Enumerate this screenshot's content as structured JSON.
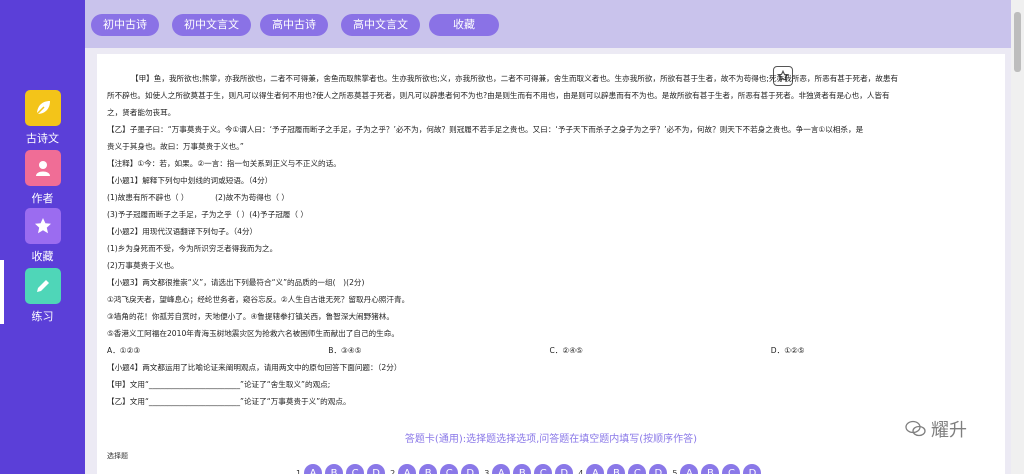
{
  "sidebar": {
    "items": [
      {
        "label": "古诗文",
        "icon": "leaf-icon",
        "color": "#f3c419"
      },
      {
        "label": "作者",
        "icon": "person-icon",
        "color": "#f06d96"
      },
      {
        "label": "收藏",
        "icon": "star-icon",
        "color": "#9b6cf0"
      },
      {
        "label": "练习",
        "icon": "pencil-icon",
        "color": "#4fd6b8"
      }
    ]
  },
  "tabs": [
    "初中古诗",
    "初中文言文",
    "高中古诗",
    "高中文言文",
    "收藏"
  ],
  "passage": [
    "【甲】鱼，我所欲也;熊掌，亦我所欲也，二者不可得兼，舍鱼而取熊掌者也。生亦我所欲也;义，亦我所欲也，二者不可得兼，舍生而取义者也。生亦我所欲，所欲有甚于生者，故不为苟得也;死亦我所恶，所恶有甚于死者，故患有",
    "所不辟也。如使人之所欲莫甚于生，则凡可以得生者何不用也?使人之所恶莫甚于死者，则凡可以辟患者何不为也?由是则生而有不用也，由是则可以辟患而有不为也。是故所欲有甚于生者，所恶有甚于死者。非独贤者有是心也，人皆有",
    "之，贤者能勿丧耳。",
    "【乙】子墨子曰：“万事莫贵于义。今①谓人曰：‘予子冠履而断子之手足，子为之乎？’必不为，何故？则冠履不若手足之贵也。又曰：‘予子天下而杀子之身子为之乎？’必不为，何故？则天下不若身之贵也。争一言①以相杀，是",
    "贵义于其身也。故曰：万事莫贵于义也。”",
    "【注释】①今：若，如果。②一言：指一句关系到正义与不正义的话。",
    "【小题1】解释下列句中划线的词或短语。（4分）",
    "(1)故患有所不辟也（ ）　　　　(2)故不为苟得也（ ）",
    "(3)予子冠履而断子之手足，子为之乎（ ）(4)予子冠履（ ）",
    "【小题2】用现代汉语翻译下列句子。（4分）",
    "(1)乡为身死而不受，今为所识穷乏者得我而为之。",
    "(2)万事莫贵于义也。",
    "【小题3】两文都很推崇“义”，请选出下列最符合“义”的品质的一组(　)(2分)",
    "①鸿飞戾天者，望峰息心；经纶世务者，窥谷忘反。②人生自古谁无死？留取丹心照汗青。",
    "③墙角的花！你孤芳自赏时，天地便小了。④鲁提辖拳打镇关西，鲁智深大闹野猪林。",
    "⑤香港义工阿福在2010年青海玉树地震灾区为抢救六名被困师生而献出了自己的生命。"
  ],
  "options": [
    "A．①②③",
    "B．③④⑤",
    "C．②④⑤",
    "D．①②⑤"
  ],
  "passage2": [
    "【小题4】两文都运用了比喻论证来阐明观点，请用两文中的原句回答下面问题：（2分）",
    "【甲】文用“________________________”论证了“舍生取义”的观点;",
    "【乙】文用“________________________”论证了“万事莫贵于义”的观点。"
  ],
  "answer_card": {
    "title": "答题卡(通用):选择题选择选项,问答题在填空题内填写(按顺序作答)",
    "subtitle": "选择题",
    "questions": [
      {
        "num": "1",
        "choices": [
          "A",
          "B",
          "C",
          "D"
        ]
      },
      {
        "num": "2",
        "choices": [
          "A",
          "B",
          "C",
          "D"
        ]
      },
      {
        "num": "3",
        "choices": [
          "A",
          "B",
          "C",
          "D"
        ]
      },
      {
        "num": "4",
        "choices": [
          "A",
          "B",
          "C",
          "D"
        ]
      },
      {
        "num": "5",
        "choices": [
          "A",
          "B",
          "C",
          "D"
        ]
      }
    ]
  },
  "watermark": "耀升",
  "colors": {
    "sidebar": "#5b3fd8",
    "accent": "#8a78e8",
    "tab": "#8a72e6",
    "topbar": "#c9c3ec"
  }
}
